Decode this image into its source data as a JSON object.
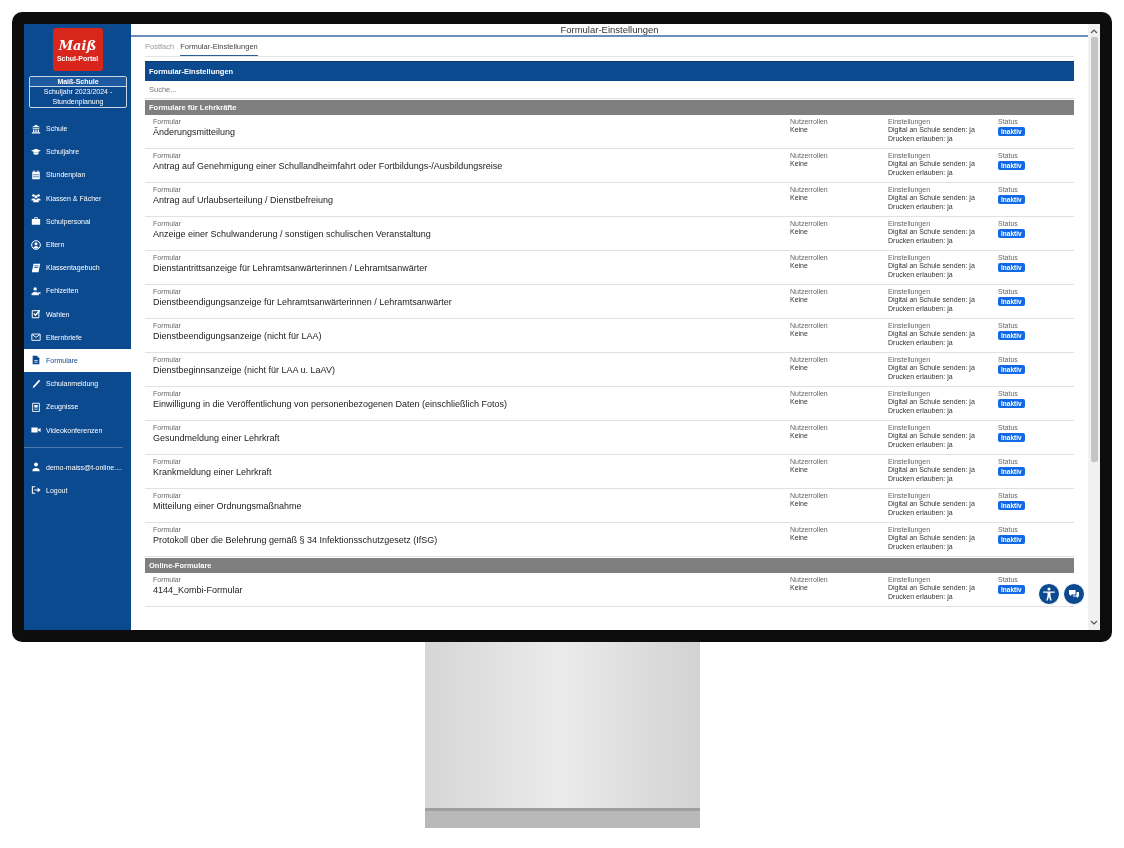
{
  "logo": {
    "script": "Maiß",
    "caption": "Schul-Portal"
  },
  "school": {
    "name": "Maiß-Schule",
    "year": "Schuljahr 2023/2024 - Stundenplanung"
  },
  "sidebar": {
    "items": [
      {
        "label": "Schule",
        "selected": false
      },
      {
        "label": "Schuljahre",
        "selected": false
      },
      {
        "label": "Stundenplan",
        "selected": false
      },
      {
        "label": "Klassen & Fächer",
        "selected": false
      },
      {
        "label": "Schulpersonal",
        "selected": false
      },
      {
        "label": "Eltern",
        "selected": false
      },
      {
        "label": "Klassentagebuch",
        "selected": false
      },
      {
        "label": "Fehlzeiten",
        "selected": false
      },
      {
        "label": "Wahlen",
        "selected": false
      },
      {
        "label": "Elternbriefe",
        "selected": false
      },
      {
        "label": "Formulare",
        "selected": true
      },
      {
        "label": "Schulanmeldung",
        "selected": false
      },
      {
        "label": "Zeugnisse",
        "selected": false
      },
      {
        "label": "Videokonferenzen",
        "selected": false
      }
    ],
    "account": [
      {
        "label": "demo-maiss@t-online...."
      },
      {
        "label": "Logout"
      }
    ]
  },
  "window": {
    "title": "Formular-Einstellungen"
  },
  "tabs": [
    {
      "label": "Postfach",
      "selected": false
    },
    {
      "label": "Formular-Einstellungen",
      "selected": true
    }
  ],
  "panel": {
    "title": "Formular-Einstellungen",
    "search": {
      "placeholder": "Suche..."
    },
    "groups": [
      {
        "title": "Formulare für Lehrkräfte",
        "rows": [
          {
            "form_label": "Formular",
            "form": "Änderungsmitteilung",
            "roles_label": "Nutzerrollen",
            "roles": "Keine",
            "settings_label": "Einstellungen",
            "settings": [
              "Digital an Schule senden: ja",
              "Drucken erlauben: ja"
            ],
            "status_label": "Status",
            "status": "Inaktiv"
          },
          {
            "form_label": "Formular",
            "form": "Antrag auf Genehmigung einer Schullandheimfahrt oder Fortbildungs-/Ausbildungsreise",
            "roles_label": "Nutzerrollen",
            "roles": "Keine",
            "settings_label": "Einstellungen",
            "settings": [
              "Digital an Schule senden: ja",
              "Drucken erlauben: ja"
            ],
            "status_label": "Status",
            "status": "Inaktiv"
          },
          {
            "form_label": "Formular",
            "form": "Antrag auf Urlaubserteilung / Dienstbefreiung",
            "roles_label": "Nutzerrollen",
            "roles": "Keine",
            "settings_label": "Einstellungen",
            "settings": [
              "Digital an Schule senden: ja",
              "Drucken erlauben: ja"
            ],
            "status_label": "Status",
            "status": "Inaktiv"
          },
          {
            "form_label": "Formular",
            "form": "Anzeige einer Schulwanderung / sonstigen schulischen Veranstaltung",
            "roles_label": "Nutzerrollen",
            "roles": "Keine",
            "settings_label": "Einstellungen",
            "settings": [
              "Digital an Schule senden: ja",
              "Drucken erlauben: ja"
            ],
            "status_label": "Status",
            "status": "Inaktiv"
          },
          {
            "form_label": "Formular",
            "form": "Dienstantrittsanzeige für Lehramtsanwärterinnen / Lehramtsanwärter",
            "roles_label": "Nutzerrollen",
            "roles": "Keine",
            "settings_label": "Einstellungen",
            "settings": [
              "Digital an Schule senden: ja",
              "Drucken erlauben: ja"
            ],
            "status_label": "Status",
            "status": "Inaktiv"
          },
          {
            "form_label": "Formular",
            "form": "Dienstbeendigungsanzeige für Lehramtsanwärterinnen / Lehramtsanwärter",
            "roles_label": "Nutzerrollen",
            "roles": "Keine",
            "settings_label": "Einstellungen",
            "settings": [
              "Digital an Schule senden: ja",
              "Drucken erlauben: ja"
            ],
            "status_label": "Status",
            "status": "Inaktiv"
          },
          {
            "form_label": "Formular",
            "form": "Dienstbeendigungsanzeige (nicht für LAA)",
            "roles_label": "Nutzerrollen",
            "roles": "Keine",
            "settings_label": "Einstellungen",
            "settings": [
              "Digital an Schule senden: ja",
              "Drucken erlauben: ja"
            ],
            "status_label": "Status",
            "status": "Inaktiv"
          },
          {
            "form_label": "Formular",
            "form": "Dienstbeginnsanzeige (nicht für LAA u. LaAV)",
            "roles_label": "Nutzerrollen",
            "roles": "Keine",
            "settings_label": "Einstellungen",
            "settings": [
              "Digital an Schule senden: ja",
              "Drucken erlauben: ja"
            ],
            "status_label": "Status",
            "status": "Inaktiv"
          },
          {
            "form_label": "Formular",
            "form": "Einwilligung in die Veröffentlichung von personenbezogenen Daten (einschließlich Fotos)",
            "roles_label": "Nutzerrollen",
            "roles": "Keine",
            "settings_label": "Einstellungen",
            "settings": [
              "Digital an Schule senden: ja",
              "Drucken erlauben: ja"
            ],
            "status_label": "Status",
            "status": "Inaktiv"
          },
          {
            "form_label": "Formular",
            "form": "Gesundmeldung einer Lehrkraft",
            "roles_label": "Nutzerrollen",
            "roles": "Keine",
            "settings_label": "Einstellungen",
            "settings": [
              "Digital an Schule senden: ja",
              "Drucken erlauben: ja"
            ],
            "status_label": "Status",
            "status": "Inaktiv"
          },
          {
            "form_label": "Formular",
            "form": "Krankmeldung einer Lehrkraft",
            "roles_label": "Nutzerrollen",
            "roles": "Keine",
            "settings_label": "Einstellungen",
            "settings": [
              "Digital an Schule senden: ja",
              "Drucken erlauben: ja"
            ],
            "status_label": "Status",
            "status": "Inaktiv"
          },
          {
            "form_label": "Formular",
            "form": "Mitteilung einer Ordnungsmaßnahme",
            "roles_label": "Nutzerrollen",
            "roles": "Keine",
            "settings_label": "Einstellungen",
            "settings": [
              "Digital an Schule senden: ja",
              "Drucken erlauben: ja"
            ],
            "status_label": "Status",
            "status": "Inaktiv"
          },
          {
            "form_label": "Formular",
            "form": "Protokoll über die Belehrung gemäß § 34 Infektionsschutzgesetz (IfSG)",
            "roles_label": "Nutzerrollen",
            "roles": "Keine",
            "settings_label": "Einstellungen",
            "settings": [
              "Digital an Schule senden: ja",
              "Drucken erlauben: ja"
            ],
            "status_label": "Status",
            "status": "Inaktiv"
          }
        ]
      },
      {
        "title": "Online-Formulare",
        "rows": [
          {
            "form_label": "Formular",
            "form": "4144_Kombi-Formular",
            "roles_label": "Nutzerrollen",
            "roles": "Keine",
            "settings_label": "Einstellungen",
            "settings": [
              "Digital an Schule senden: ja",
              "Drucken erlauben: ja"
            ],
            "status_label": "Status",
            "status": "Inaktiv"
          }
        ]
      }
    ]
  }
}
